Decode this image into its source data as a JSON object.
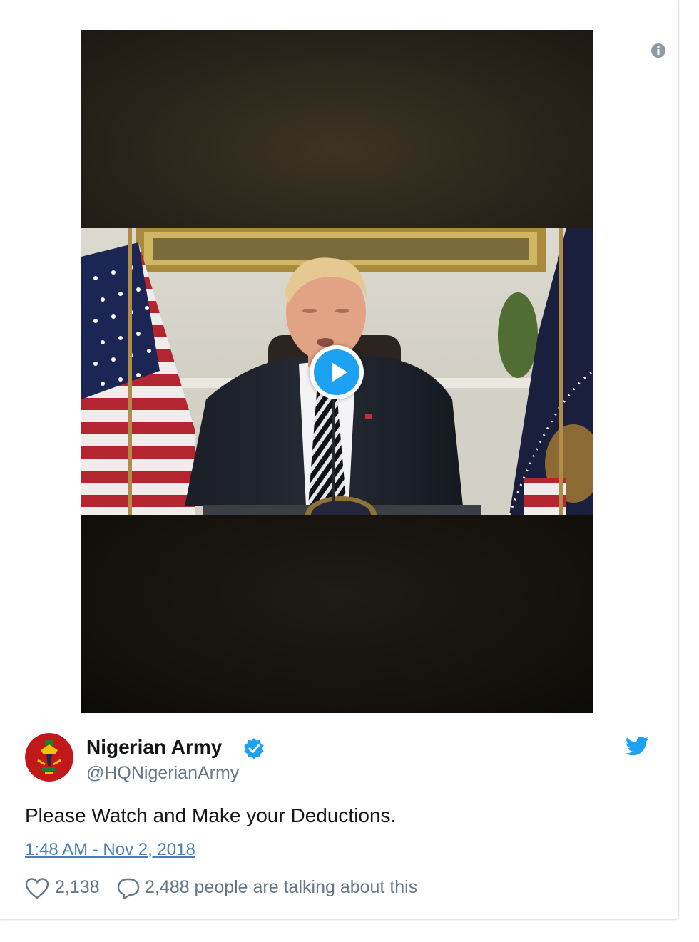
{
  "tweet": {
    "display_name": "Nigerian Army",
    "handle": "@HQNigerianArmy",
    "verified": true,
    "text": "Please Watch and Make your Deductions.",
    "timestamp": "1:48 AM - Nov 2, 2018",
    "likes": "2,138",
    "talking": "2,488 people are talking about this"
  },
  "icons": {
    "info": "info-circle-icon",
    "play": "play-icon",
    "verified": "verified-badge-icon",
    "brand": "twitter-bird-icon",
    "like": "heart-icon",
    "reply": "speech-bubble-icon"
  },
  "colors": {
    "accent": "#1da1f2",
    "link": "#4a7fb5",
    "muted": "#657786",
    "text": "#14171a"
  }
}
